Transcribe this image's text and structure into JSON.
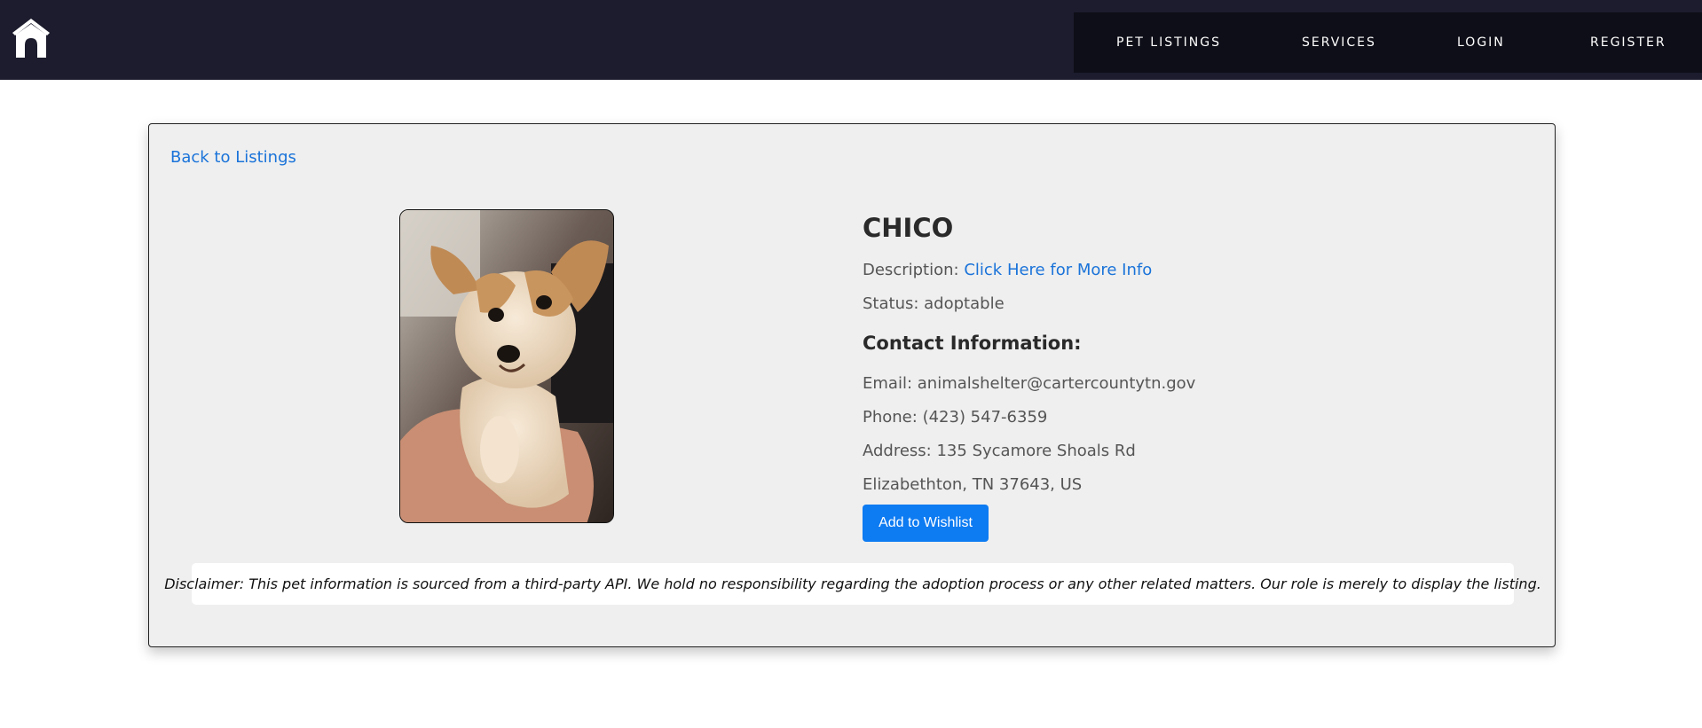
{
  "header": {
    "logo_icon": "dog-house-icon",
    "nav": [
      {
        "label": "PET LISTINGS"
      },
      {
        "label": "SERVICES"
      },
      {
        "label": "LOGIN"
      },
      {
        "label": "REGISTER"
      }
    ]
  },
  "pet": {
    "back_label": "Back to Listings",
    "name": "CHICO",
    "description_label": "Description:",
    "description_link": "Click Here for More Info",
    "status_label": "Status:",
    "status_value": "adoptable",
    "contact_heading": "Contact Information:",
    "email_label": "Email:",
    "email_value": "animalshelter@cartercountytn.gov",
    "phone_label": "Phone:",
    "phone_value": "(423) 547-6359",
    "address_label": "Address:",
    "address_line1": "135 Sycamore Shoals Rd",
    "address_line2": "Elizabethton, TN 37643, US",
    "wishlist_label": "Add to Wishlist"
  },
  "disclaimer": "Disclaimer: This pet information is sourced from a third-party API. We hold no responsibility regarding the adoption process or any other related matters. Our role is merely to display the listing.",
  "colors": {
    "header_bg": "#1c1c2e",
    "nav_bg": "#0e0e18",
    "link": "#1a73d9",
    "button": "#0d7bf2",
    "card_bg": "#efefef"
  }
}
